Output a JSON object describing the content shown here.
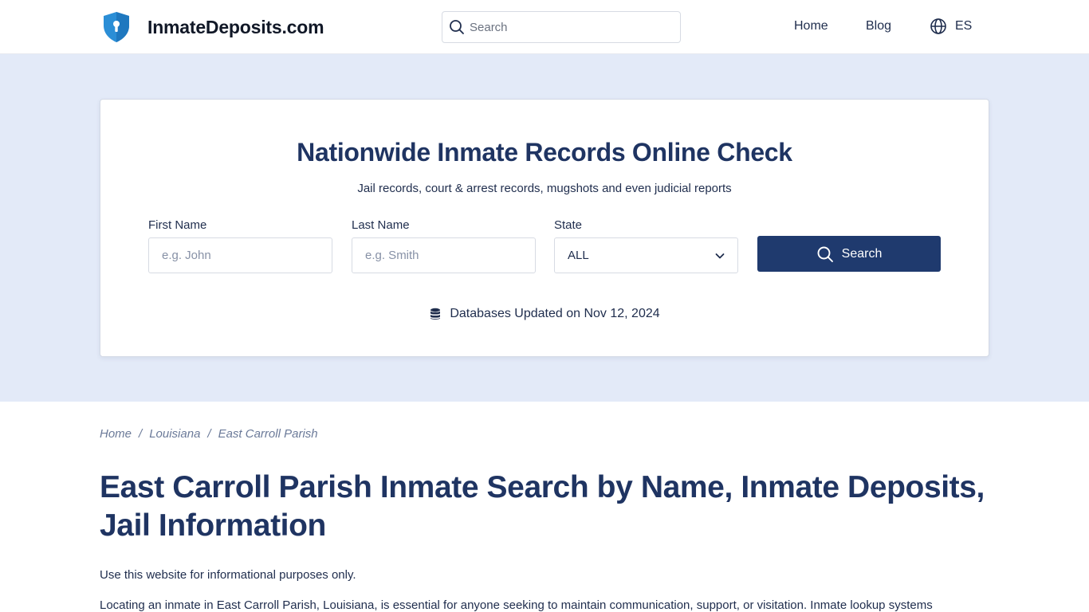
{
  "header": {
    "logo_text": "InmateDeposits.com",
    "search_placeholder": "Search",
    "nav": {
      "home": "Home",
      "blog": "Blog",
      "language": "ES"
    }
  },
  "hero": {
    "title": "Nationwide Inmate Records Online Check",
    "subtitle": "Jail records, court & arrest records, mugshots and even judicial reports",
    "form": {
      "first_name_label": "First Name",
      "first_name_placeholder": "e.g. John",
      "last_name_label": "Last Name",
      "last_name_placeholder": "e.g. Smith",
      "state_label": "State",
      "state_value": "ALL",
      "search_button": "Search"
    },
    "db_updated": "Databases Updated on Nov 12, 2024"
  },
  "breadcrumb": {
    "items": [
      "Home",
      "Louisiana",
      "East Carroll Parish"
    ],
    "separator": "/"
  },
  "main": {
    "title": "East Carroll Parish Inmate Search by Name, Inmate Deposits, Jail Information",
    "paragraphs": [
      "Use this website for informational purposes only.",
      "Locating an inmate in East Carroll Parish, Louisiana, is essential for anyone seeking to maintain communication, support, or visitation. Inmate lookup systems"
    ]
  },
  "colors": {
    "brand_navy": "#1f3462",
    "button_navy": "#1f3a6e",
    "hero_bg": "#e3eaf8",
    "shield_blue": "#2b8ed6"
  },
  "icons": {
    "logo": "shield-keyhole-icon",
    "search": "search-icon",
    "language": "globe-icon",
    "dropdown": "chevron-down-icon",
    "database": "database-icon"
  }
}
